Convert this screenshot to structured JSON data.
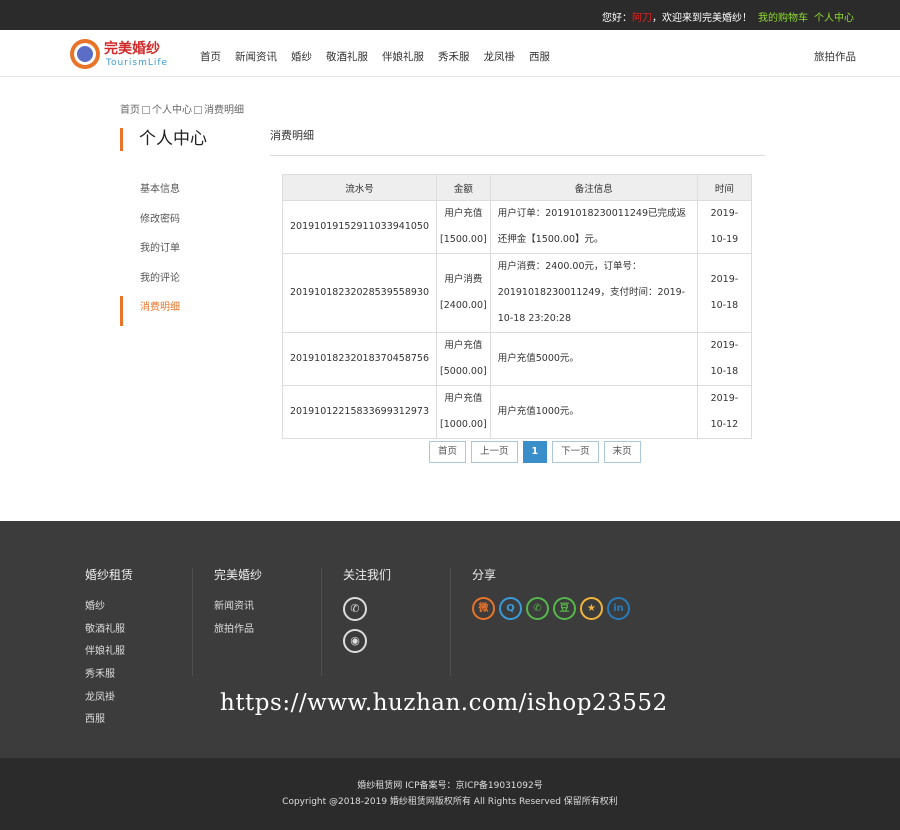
{
  "topbar": {
    "greeting": "您好：",
    "username": "阿刀",
    "welcome": "，欢迎来到完美婚纱！",
    "cart": "我的购物车",
    "center": "个人中心"
  },
  "logo": {
    "title": "完美婚纱",
    "subtitle": "TourismLife"
  },
  "nav": {
    "items": [
      "首页",
      "新闻资讯",
      "婚纱",
      "敬酒礼服",
      "伴娘礼服",
      "秀禾服",
      "龙凤褂",
      "西服"
    ],
    "right": "旅拍作品"
  },
  "breadcrumb": [
    "首页",
    "个人中心",
    "消费明细"
  ],
  "sidebar": {
    "title": "个人中心",
    "items": [
      "基本信息",
      "修改密码",
      "我的订单",
      "我的评论",
      "消费明细"
    ],
    "active_index": 4
  },
  "main": {
    "title": "消费明细",
    "table": {
      "headers": [
        "流水号",
        "金额",
        "备注信息",
        "时间"
      ],
      "rows": [
        {
          "serial": "20191019152911033941050",
          "type": "用户充值",
          "amount": "[1500.00]",
          "note": "用户订单：20191018230011249已完成返还押金【1500.00】元。",
          "date": "2019-10-19",
          "kind": "blue"
        },
        {
          "serial": "20191018232028539558930",
          "type": "用户消费",
          "amount": "[2400.00]",
          "note": "用户消费：2400.00元，订单号：20191018230011249，支付时间：2019-10-18 23:20:28",
          "date": "2019-10-18",
          "kind": "red"
        },
        {
          "serial": "20191018232018370458756",
          "type": "用户充值",
          "amount": "[5000.00]",
          "note": "用户充值5000元。",
          "date": "2019-10-18",
          "kind": "blue"
        },
        {
          "serial": "20191012215833699312973",
          "type": "用户充值",
          "amount": "[1000.00]",
          "note": "用户充值1000元。",
          "date": "2019-10-12",
          "kind": "blue"
        }
      ]
    },
    "pager": {
      "first": "首页",
      "prev": "上一页",
      "current": "1",
      "next": "下一页",
      "last": "末页"
    }
  },
  "footer": {
    "col1": {
      "title": "婚纱租赁",
      "links": [
        "婚纱",
        "敬酒礼服",
        "伴娘礼服",
        "秀禾服",
        "龙凤褂",
        "西服"
      ]
    },
    "col2": {
      "title": "完美婚纱",
      "links": [
        "新闻资讯",
        "旅拍作品"
      ]
    },
    "col3": {
      "title": "关注我们",
      "icons": [
        "wechat-icon",
        "weibo-icon"
      ]
    },
    "col4": {
      "title": "分享",
      "icons": [
        {
          "name": "weibo-share-icon",
          "glyph": "微",
          "color": "#e8742a"
        },
        {
          "name": "qq-share-icon",
          "glyph": "Q",
          "color": "#3a9bd8"
        },
        {
          "name": "wechat-share-icon",
          "glyph": "✆",
          "color": "#56b84a"
        },
        {
          "name": "douban-share-icon",
          "glyph": "豆",
          "color": "#56b84a"
        },
        {
          "name": "qzone-share-icon",
          "glyph": "★",
          "color": "#f0b43a"
        },
        {
          "name": "linkedin-share-icon",
          "glyph": "in",
          "color": "#2a7ab8"
        }
      ]
    },
    "watermark": "https://www.huzhan.com/ishop23552",
    "icp": "婚纱租赁网 ICP备案号：京ICP备19031092号",
    "copyright": "Copyright @2018-2019 婚纱租赁网版权所有 All Rights Reserved 保留所有权利"
  }
}
